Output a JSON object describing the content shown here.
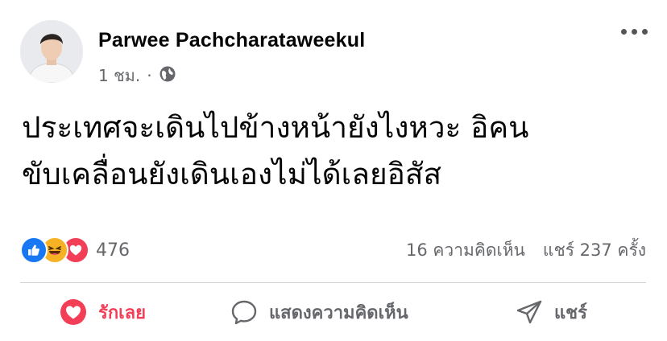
{
  "post": {
    "author": "Parwee Pachcharataweekul",
    "time": "1 ชม.",
    "dot": "·",
    "privacy_icon": "globe-icon",
    "lines": [
      "ประเทศจะเดินไปข้างหน้ายังไงหวะ อิคน",
      "ขับเคลื่อนยังเดินเองไม่ได้เลยอิสัส"
    ]
  },
  "stats": {
    "reaction_icons": [
      "like-icon",
      "haha-icon",
      "love-icon"
    ],
    "reactions": "476",
    "comments": "16 ความคิดเห็น",
    "shares": "แชร์ 237 ครั้ง"
  },
  "actions": {
    "love_label": "รักเลย",
    "comment_label": "แสดงความคิดเห็น",
    "share_label": "แชร์"
  },
  "colors": {
    "love": "#f33e58",
    "like": "#1877f2",
    "haha": "#f7b125",
    "secondary_text": "#65676b"
  }
}
